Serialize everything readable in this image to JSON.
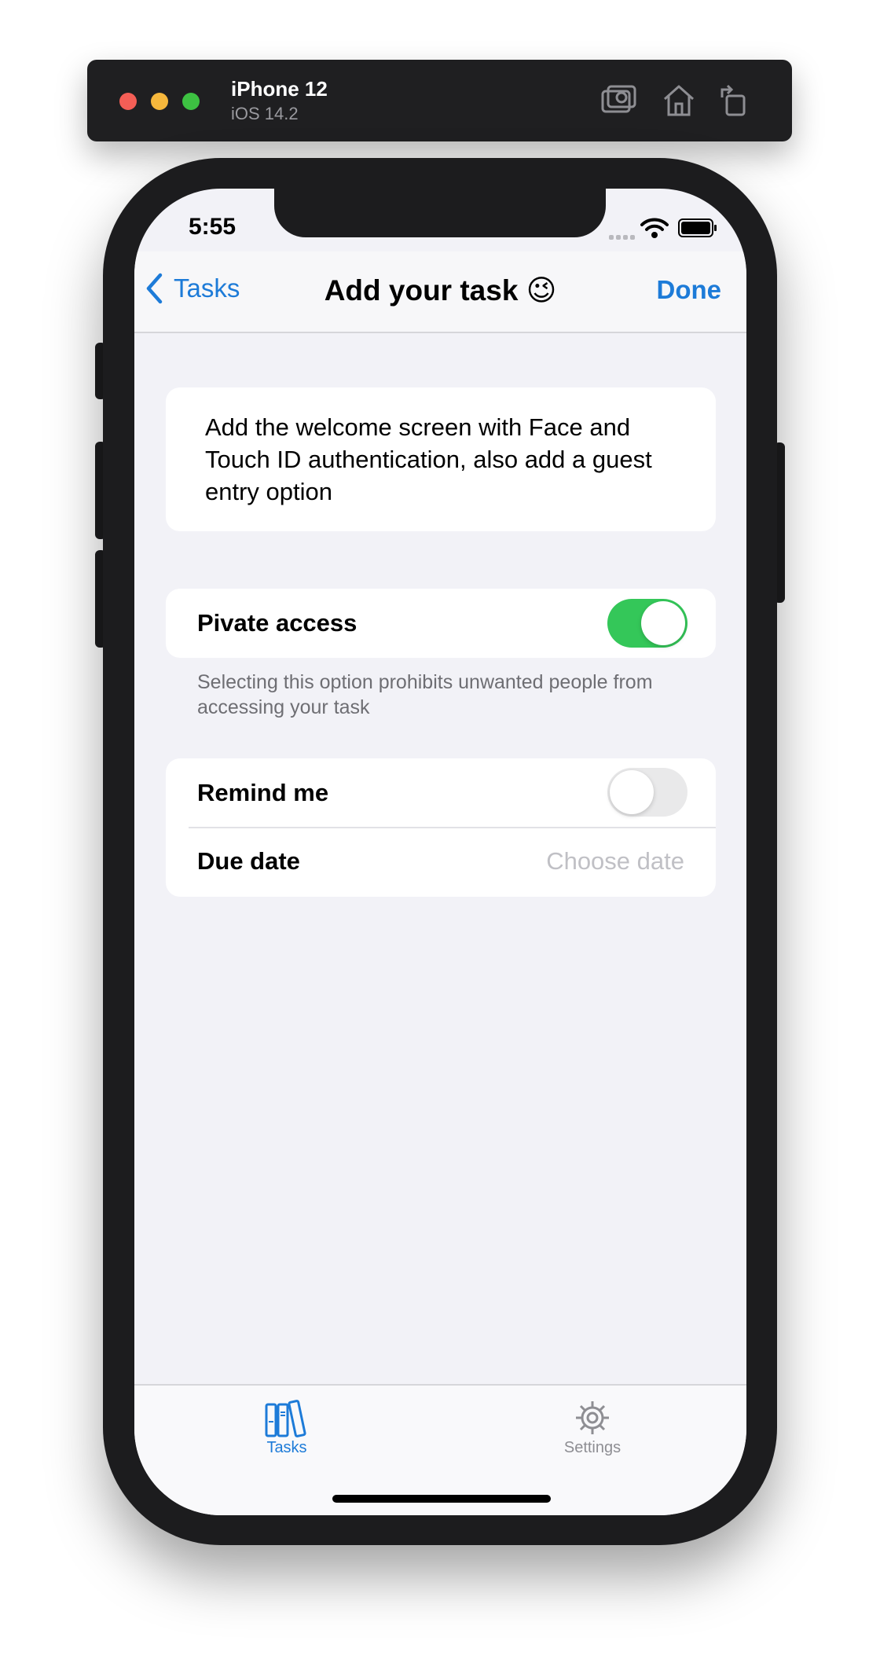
{
  "simulator": {
    "device_name": "iPhone 12",
    "os_version": "iOS 14.2",
    "tools": [
      "screenshot-icon",
      "home-icon",
      "rotate-icon"
    ]
  },
  "status_bar": {
    "time": "5:55"
  },
  "nav": {
    "back_label": "Tasks",
    "title": "Add your task 😉",
    "done_label": "Done"
  },
  "task": {
    "text": "Add the welcome screen with Face and Touch ID authentication, also add a guest entry option"
  },
  "private_access": {
    "label": "Pivate access",
    "enabled": true,
    "footer": "Selecting this option prohibits unwanted people from accessing your task"
  },
  "reminder": {
    "remind_label": "Remind me",
    "remind_enabled": false,
    "due_label": "Due date",
    "due_value": "Choose date"
  },
  "tabbar": {
    "tasks_label": "Tasks",
    "settings_label": "Settings",
    "active": "Tasks"
  },
  "colors": {
    "accent": "#1d7bd8",
    "toggle_on": "#34c759",
    "background": "#f2f2f7"
  }
}
